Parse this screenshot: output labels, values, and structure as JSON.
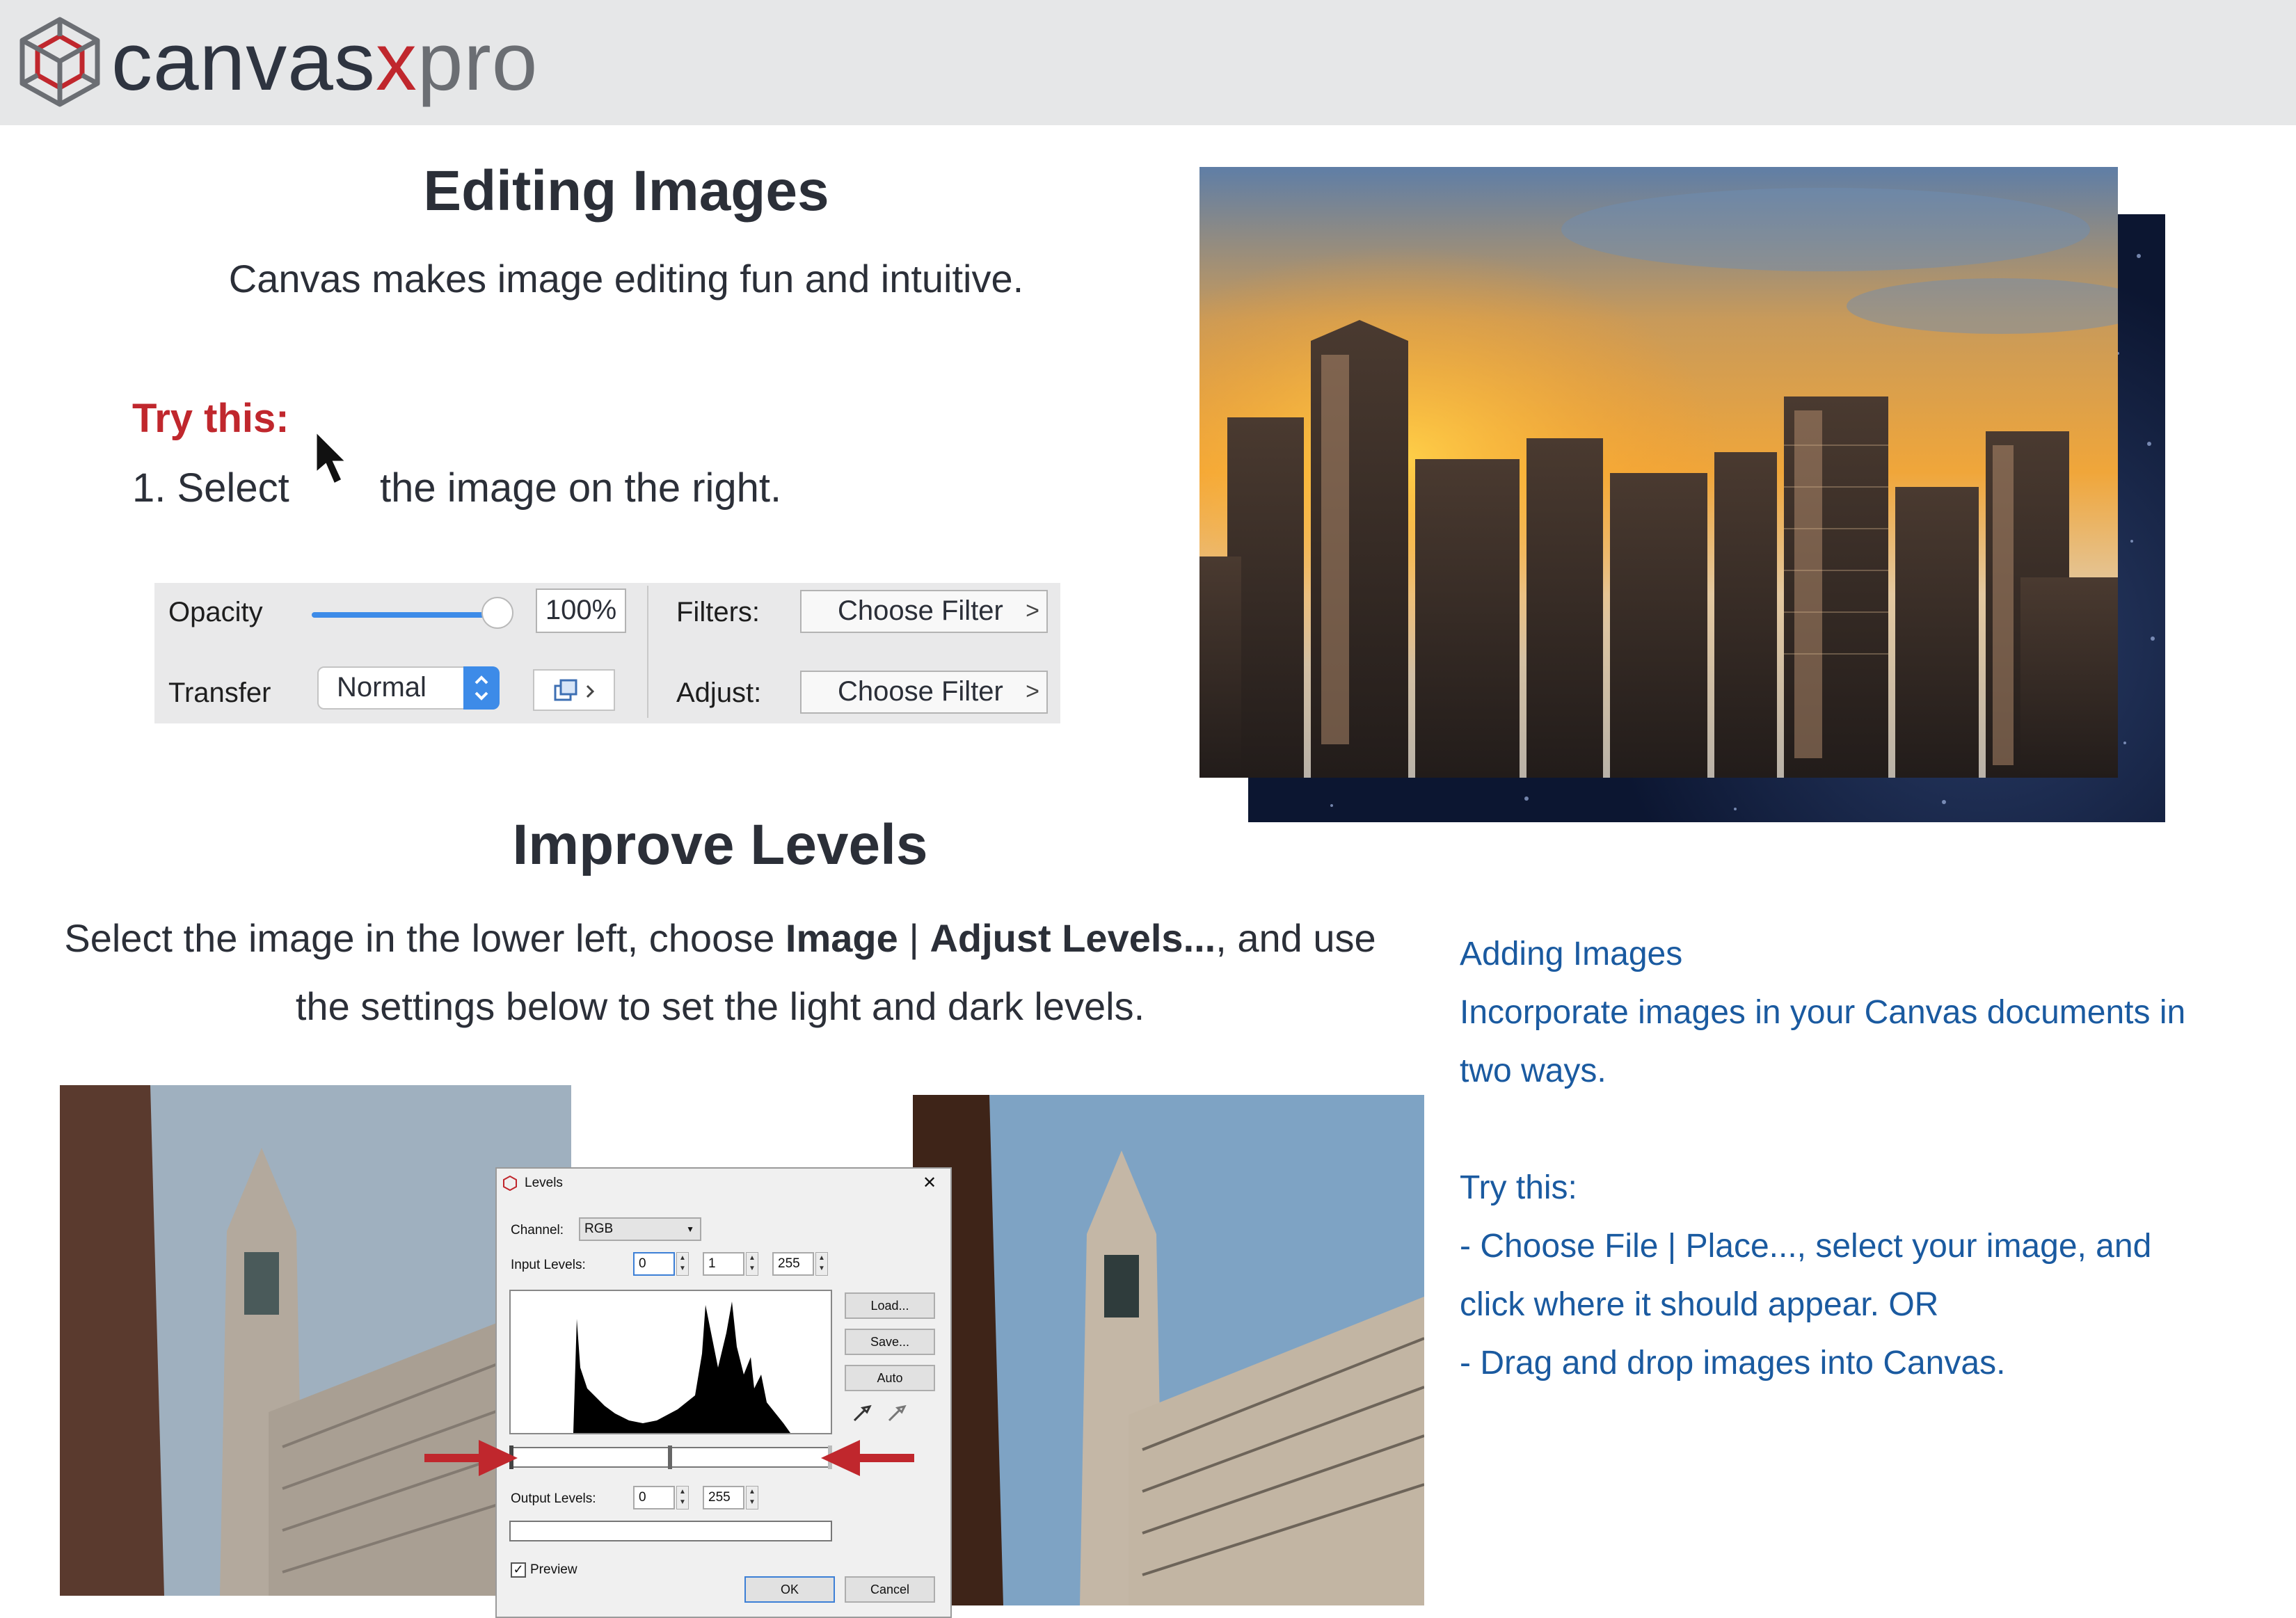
{
  "header": {
    "brand_parts": [
      "canvas",
      "x",
      "pro"
    ],
    "logo_icon": "canvas-cube-logo-icon"
  },
  "editing": {
    "heading": "Editing Images",
    "subtitle": "Canvas makes image editing fun and intuitive.",
    "try_label": "Try this:",
    "step1_prefix": "1. Select",
    "step1_suffix": "the image on the right.",
    "cursor_icon": "arrow-cursor-icon"
  },
  "toolbar": {
    "opacity_label": "Opacity",
    "opacity_value": "100%",
    "opacity_level": 1.0,
    "transfer_label": "Transfer",
    "transfer_value": "Normal",
    "filters_label": "Filters:",
    "filters_button": "Choose Filter",
    "adjust_label": "Adjust:",
    "adjust_button": "Choose Filter",
    "chevron": ">",
    "accent": "#3d8be8"
  },
  "improve": {
    "heading": "Improve Levels",
    "body_1": "Select the image in the lower left, choose ",
    "body_image": "Image",
    "body_sep": " | ",
    "body_adjust": "Adjust Levels...",
    "body_2": ", and use the settings below to set the light and dark levels."
  },
  "levels_dialog": {
    "title": "Levels",
    "close": "✕",
    "channel_label": "Channel:",
    "channel_value": "RGB",
    "input_label": "Input Levels:",
    "input_black": "0",
    "input_gamma": "1",
    "input_white": "255",
    "buttons": [
      "Load...",
      "Save...",
      "Auto"
    ],
    "output_label": "Output Levels:",
    "output_black": "0",
    "output_white": "255",
    "preview_label": "Preview",
    "preview_checked": true,
    "ok": "OK",
    "cancel": "Cancel"
  },
  "info": {
    "title": "Adding Images",
    "line1": "Incorporate images in your Canvas documents in",
    "line2": "two ways.",
    "try": "Try this:",
    "item1a": "- Choose File | Place..., select your image, and",
    "item1b": "click where it should appear. OR",
    "item2": "- Drag and drop images into Canvas.",
    "color": "#1a5aa0"
  },
  "colors": {
    "header_bg": "#e6e7e8",
    "brand_red": "#c0272d",
    "heading": "#2b2f38",
    "arrow_red": "#c0272d"
  }
}
